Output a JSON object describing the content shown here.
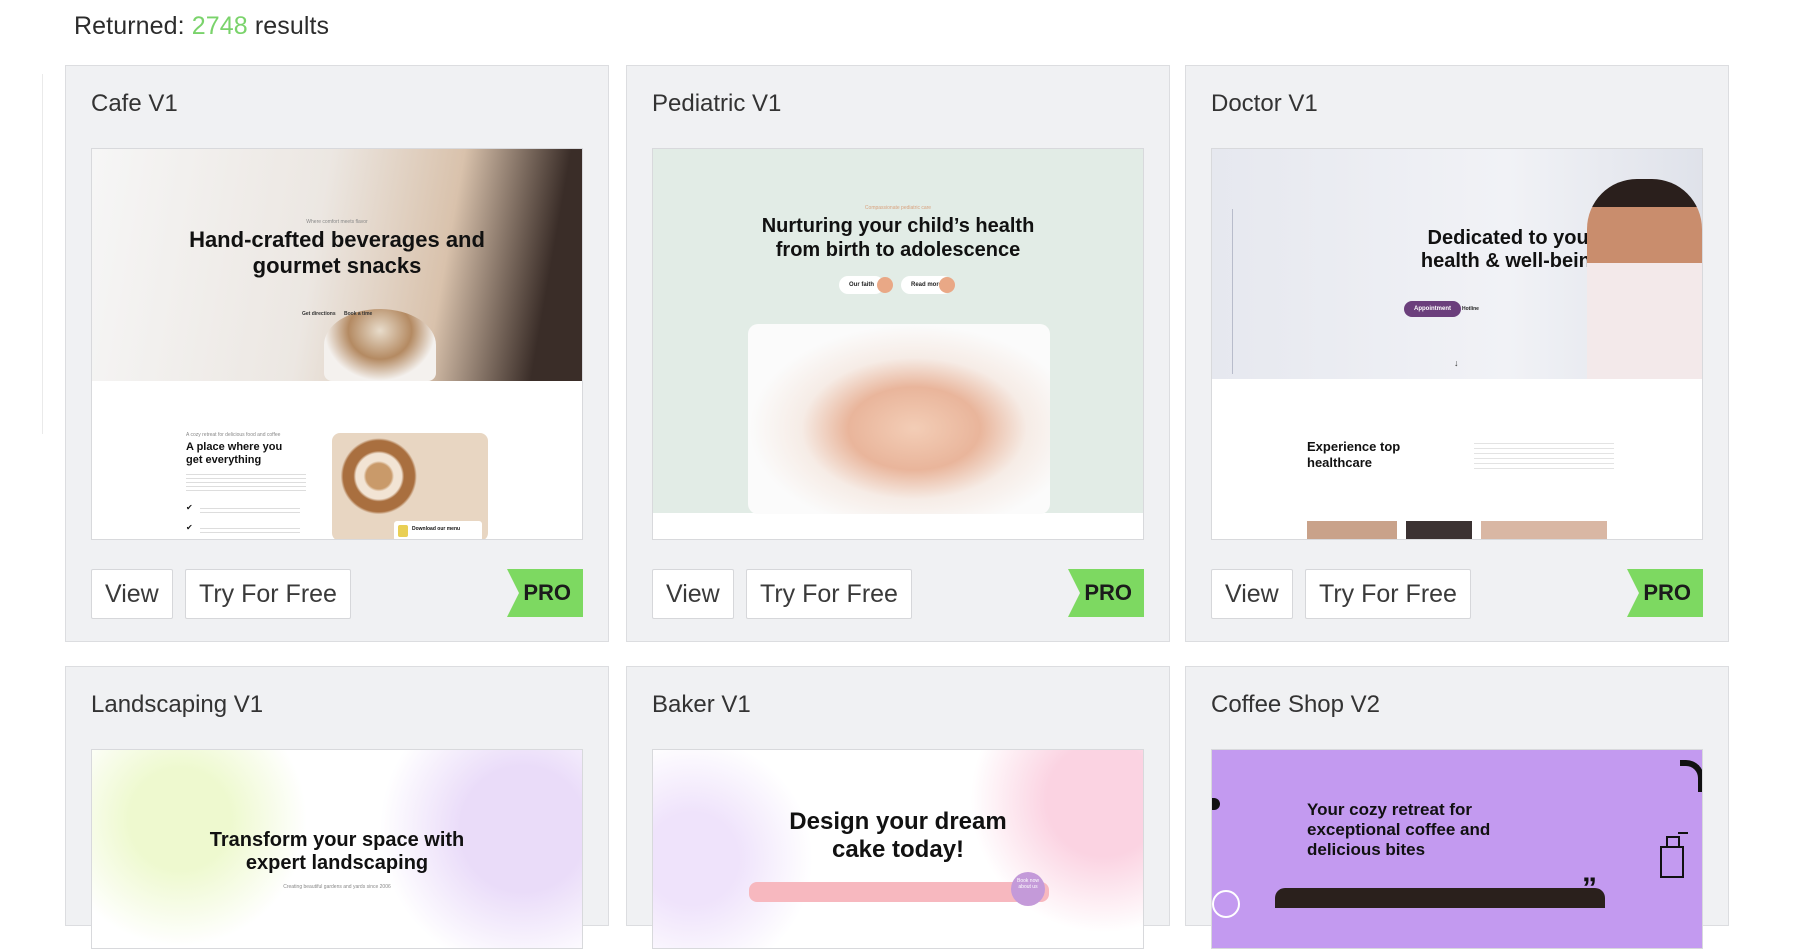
{
  "results": {
    "prefix": "Returned:",
    "count": "2748",
    "suffix": "results"
  },
  "buttons": {
    "view": "View",
    "try": "Try For Free",
    "pro": "PRO"
  },
  "cards": [
    {
      "title": "Cafe V1",
      "thumb": {
        "kicker": "Where comfort meets flavor",
        "headline1": "Hand-crafted beverages and",
        "headline2": "gourmet snacks",
        "link1": "Get directions",
        "link2": "Book a time",
        "sub_kicker": "A cozy retreat for delicious food and coffee",
        "sub_heading1": "A place where you",
        "sub_heading2": "get everything",
        "download": "Download our menu"
      }
    },
    {
      "title": "Pediatric V1",
      "thumb": {
        "kicker": "Compassionate pediatric care",
        "headline1": "Nurturing your child’s health",
        "headline2": "from birth to adolescence",
        "btn1": "Our faith",
        "btn2": "Read more"
      }
    },
    {
      "title": "Doctor V1",
      "thumb": {
        "headline1": "Dedicated to your",
        "headline2": "health & well-being",
        "appointment": "Appointment",
        "hotline": "Hotline",
        "sub_heading1": "Experience top",
        "sub_heading2": "healthcare"
      }
    },
    {
      "title": "Landscaping V1",
      "thumb": {
        "headline1": "Transform your space with",
        "headline2": "expert landscaping",
        "sub": "Creating beautiful gardens and yards since 2006"
      }
    },
    {
      "title": "Baker V1",
      "thumb": {
        "headline1": "Design your dream",
        "headline2": "cake today!",
        "badge": "Book now about us"
      }
    },
    {
      "title": "Coffee Shop V2",
      "thumb": {
        "headline1": "Your cozy retreat for",
        "headline2": "exceptional coffee and",
        "headline3": "delicious bites"
      }
    }
  ],
  "colors": {
    "accent_green": "#7ad36b",
    "pro_badge": "#7dd961",
    "card_bg": "#f0f1f3",
    "doctor_button": "#6b3f7c",
    "coffee_purple": "#c39af0"
  }
}
